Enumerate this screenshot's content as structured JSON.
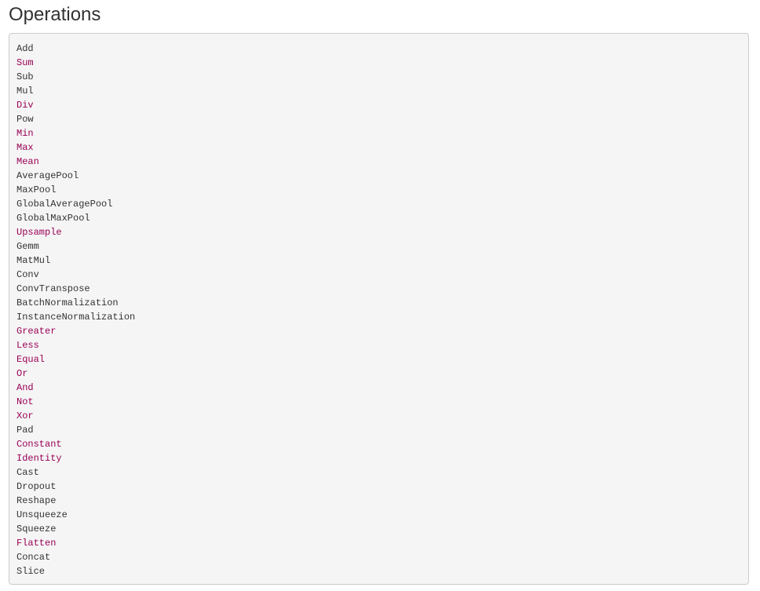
{
  "page": {
    "title": "Operations"
  },
  "colors": {
    "plain": "#333333",
    "keyword": "#990055",
    "block_background": "#f5f5f5",
    "block_border": "#cccccc"
  },
  "operations": [
    {
      "name": "Add",
      "style": "plain"
    },
    {
      "name": "Sum",
      "style": "keyword"
    },
    {
      "name": "Sub",
      "style": "plain"
    },
    {
      "name": "Mul",
      "style": "plain"
    },
    {
      "name": "Div",
      "style": "keyword"
    },
    {
      "name": "Pow",
      "style": "plain"
    },
    {
      "name": "Min",
      "style": "keyword"
    },
    {
      "name": "Max",
      "style": "keyword"
    },
    {
      "name": "Mean",
      "style": "keyword"
    },
    {
      "name": "AveragePool",
      "style": "plain"
    },
    {
      "name": "MaxPool",
      "style": "plain"
    },
    {
      "name": "GlobalAveragePool",
      "style": "plain"
    },
    {
      "name": "GlobalMaxPool",
      "style": "plain"
    },
    {
      "name": "Upsample",
      "style": "keyword"
    },
    {
      "name": "Gemm",
      "style": "plain"
    },
    {
      "name": "MatMul",
      "style": "plain"
    },
    {
      "name": "Conv",
      "style": "plain"
    },
    {
      "name": "ConvTranspose",
      "style": "plain"
    },
    {
      "name": "BatchNormalization",
      "style": "plain"
    },
    {
      "name": "InstanceNormalization",
      "style": "plain"
    },
    {
      "name": "Greater",
      "style": "keyword"
    },
    {
      "name": "Less",
      "style": "keyword"
    },
    {
      "name": "Equal",
      "style": "keyword"
    },
    {
      "name": "Or",
      "style": "keyword"
    },
    {
      "name": "And",
      "style": "keyword"
    },
    {
      "name": "Not",
      "style": "keyword"
    },
    {
      "name": "Xor",
      "style": "keyword"
    },
    {
      "name": "Pad",
      "style": "plain"
    },
    {
      "name": "Constant",
      "style": "keyword"
    },
    {
      "name": "Identity",
      "style": "keyword"
    },
    {
      "name": "Cast",
      "style": "plain"
    },
    {
      "name": "Dropout",
      "style": "plain"
    },
    {
      "name": "Reshape",
      "style": "plain"
    },
    {
      "name": "Unsqueeze",
      "style": "plain"
    },
    {
      "name": "Squeeze",
      "style": "plain"
    },
    {
      "name": "Flatten",
      "style": "keyword"
    },
    {
      "name": "Concat",
      "style": "plain"
    },
    {
      "name": "Slice",
      "style": "plain"
    }
  ]
}
